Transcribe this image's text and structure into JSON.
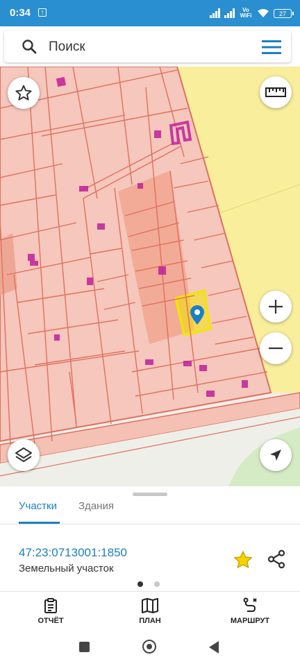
{
  "status_bar": {
    "time": "0:34",
    "network_label": "Vo WiFi",
    "battery": "27"
  },
  "search": {
    "placeholder": "Поиск"
  },
  "icons": {
    "search": "search-icon",
    "menu": "hamburger-menu-icon",
    "favorite": "star-icon",
    "ruler": "ruler-icon",
    "zoom_in": "plus-icon",
    "zoom_out": "minus-icon",
    "layers": "layers-icon",
    "location": "navigation-arrow-icon",
    "share": "share-icon",
    "report": "report-clipboard-icon",
    "plan": "map-plan-icon",
    "route": "route-icon"
  },
  "colors": {
    "accent": "#2a8fd0",
    "parcel_fill": "#f6c7bc",
    "parcel_border": "#e0705d",
    "highlight": "#f2e600",
    "marker": "#1b7fc4",
    "building": "#c0209a",
    "favorite_star": "#f0c000"
  },
  "tabs": [
    {
      "label": "Участки"
    },
    {
      "label": "Здания"
    }
  ],
  "parcel": {
    "cadastral_number": "47:23:0713001:1850",
    "type": "Земельный участок"
  },
  "actions": [
    {
      "label": "ОТЧЁТ"
    },
    {
      "label": "ПЛАН"
    },
    {
      "label": "МАРШРУТ"
    }
  ]
}
